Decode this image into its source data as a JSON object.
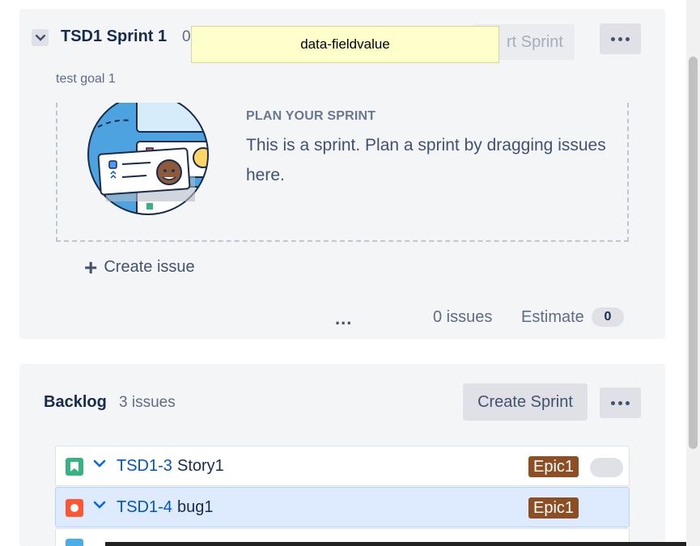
{
  "sprint": {
    "name": "TSD1 Sprint 1",
    "count": "0",
    "start_button": "rt Sprint",
    "goal": "test goal 1",
    "plan_title": "PLAN YOUR SPRINT",
    "plan_text": "This is a sprint. Plan a sprint by dragging issues here.",
    "create_issue": "Create issue",
    "footer_more": "...",
    "issues_count": "0 issues",
    "estimate_label": "Estimate",
    "estimate_value": "0"
  },
  "tooltip": {
    "text": "data-fieldvalue"
  },
  "backlog": {
    "title": "Backlog",
    "count": "3 issues",
    "create_sprint": "Create Sprint",
    "issues": [
      {
        "type": "story",
        "key": "TSD1-3",
        "summary": "Story1",
        "epic": "Epic1",
        "type_color": "#36b37e"
      },
      {
        "type": "bug",
        "key": "TSD1-4",
        "summary": "bug1",
        "epic": "Epic1",
        "type_color": "#ff5630"
      }
    ]
  },
  "colors": {
    "panel_bg": "#f4f5f7",
    "link": "#0052cc",
    "epic": "#8d4e24",
    "selected_row": "#deebff"
  }
}
